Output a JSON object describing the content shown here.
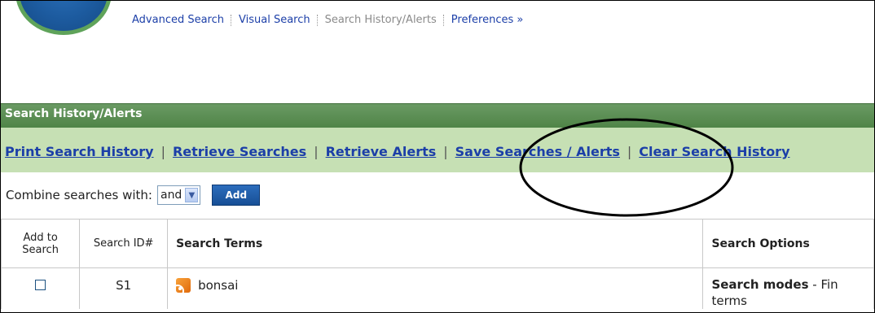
{
  "top_nav": {
    "items": [
      {
        "label": "Advanced Search",
        "current": false
      },
      {
        "label": "Visual Search",
        "current": false
      },
      {
        "label": "Search History/Alerts",
        "current": true
      },
      {
        "label": "Preferences »",
        "current": false
      }
    ]
  },
  "section": {
    "title": "Search History/Alerts"
  },
  "links_bar": {
    "print": "Print Search History",
    "retrieve_searches": "Retrieve Searches",
    "retrieve_alerts": "Retrieve Alerts",
    "save": "Save Searches / Alerts",
    "clear": "Clear Search History",
    "separator": "|"
  },
  "combine": {
    "label": "Combine searches with:",
    "selected": "and",
    "add_label": "Add"
  },
  "table": {
    "headers": {
      "add_line1": "Add to",
      "add_line2": "Search",
      "id": "Search ID#",
      "terms": "Search Terms",
      "options": "Search Options"
    },
    "rows": [
      {
        "id": "S1",
        "terms": "bonsai",
        "options_label": "Search modes",
        "options_rest": " - Fin",
        "options_line2": "terms"
      }
    ]
  },
  "colors": {
    "link": "#1c3fa8",
    "section_bar": "#4f8447",
    "links_bar_bg": "#c6e0b4",
    "add_button": "#174f96"
  }
}
